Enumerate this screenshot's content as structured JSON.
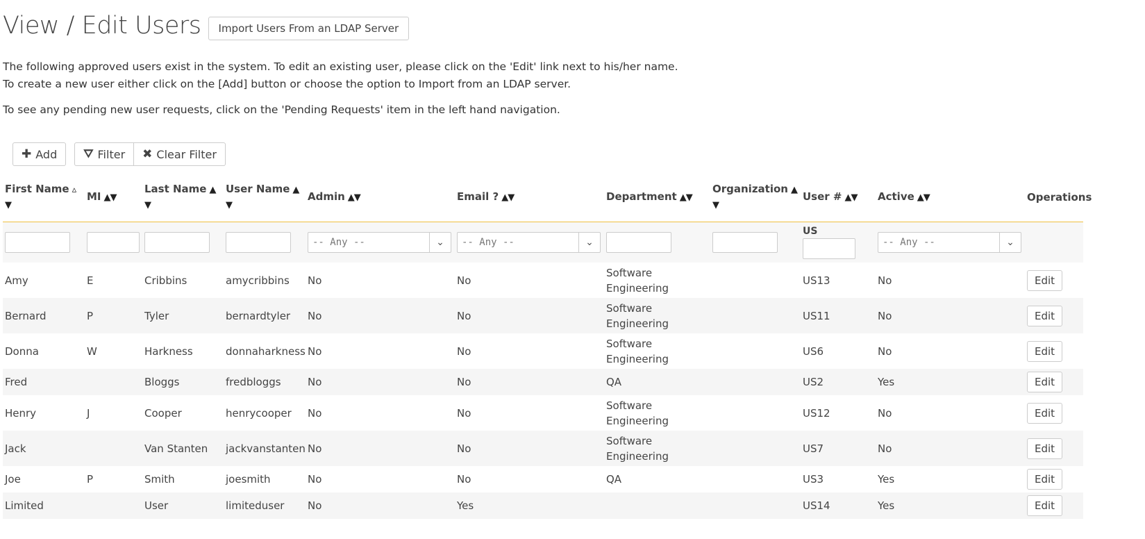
{
  "header": {
    "title": "View / Edit Users",
    "import_label": "Import Users From an LDAP Server"
  },
  "intro": {
    "line1": "The following approved users exist in the system. To edit an existing user, please click on the 'Edit' link next to his/her name.",
    "line2": "To create a new user either click on the [Add] button or choose the option to Import from an LDAP server.",
    "line3": "To see any pending new user requests, click on the 'Pending Requests' item in the left hand navigation."
  },
  "toolbar": {
    "add_label": "Add",
    "filter_label": "Filter",
    "clear_filter_label": "Clear Filter"
  },
  "columns": {
    "first_name": "First Name",
    "mi": "MI",
    "last_name": "Last Name",
    "user_name": "User Name",
    "admin": "Admin",
    "email": "Email ?",
    "department": "Department",
    "organization": "Organization",
    "user_no": "User #",
    "active": "Active",
    "operations": "Operations"
  },
  "sort_icons": {
    "first_name": "▵",
    "both": "▲▼",
    "up": "▲",
    "down": "▼"
  },
  "filters": {
    "any": "-- Any --",
    "user_prefix": "US"
  },
  "rows": [
    {
      "first": "Amy",
      "mi": "E",
      "last": "Cribbins",
      "user": "amycribbins",
      "admin": "No",
      "email": "No",
      "dept1": "Software",
      "dept2": "Engineering",
      "num": "US13",
      "active": "No",
      "edit": "Edit"
    },
    {
      "first": "Bernard",
      "mi": "P",
      "last": "Tyler",
      "user": "bernardtyler",
      "admin": "No",
      "email": "No",
      "dept1": "Software",
      "dept2": "Engineering",
      "num": "US11",
      "active": "No",
      "edit": "Edit"
    },
    {
      "first": "Donna",
      "mi": "W",
      "last": "Harkness",
      "user": "donnaharkness",
      "admin": "No",
      "email": "No",
      "dept1": "Software",
      "dept2": "Engineering",
      "num": "US6",
      "active": "No",
      "edit": "Edit"
    },
    {
      "first": "Fred",
      "mi": "",
      "last": "Bloggs",
      "user": "fredbloggs",
      "admin": "No",
      "email": "No",
      "dept1": "QA",
      "dept2": "",
      "num": "US2",
      "active": "Yes",
      "edit": "Edit"
    },
    {
      "first": "Henry",
      "mi": "J",
      "last": "Cooper",
      "user": "henrycooper",
      "admin": "No",
      "email": "No",
      "dept1": "Software",
      "dept2": "Engineering",
      "num": "US12",
      "active": "No",
      "edit": "Edit"
    },
    {
      "first": "Jack",
      "mi": "",
      "last": "Van Stanten",
      "user": "jackvanstanten",
      "admin": "No",
      "email": "No",
      "dept1": "Software",
      "dept2": "Engineering",
      "num": "US7",
      "active": "No",
      "edit": "Edit"
    },
    {
      "first": "Joe",
      "mi": "P",
      "last": "Smith",
      "user": "joesmith",
      "admin": "No",
      "email": "No",
      "dept1": "QA",
      "dept2": "",
      "num": "US3",
      "active": "Yes",
      "edit": "Edit"
    },
    {
      "first": "Limited",
      "mi": "",
      "last": "User",
      "user": "limiteduser",
      "admin": "No",
      "email": "Yes",
      "dept1": "",
      "dept2": "",
      "num": "US14",
      "active": "Yes",
      "edit": "Edit"
    }
  ]
}
